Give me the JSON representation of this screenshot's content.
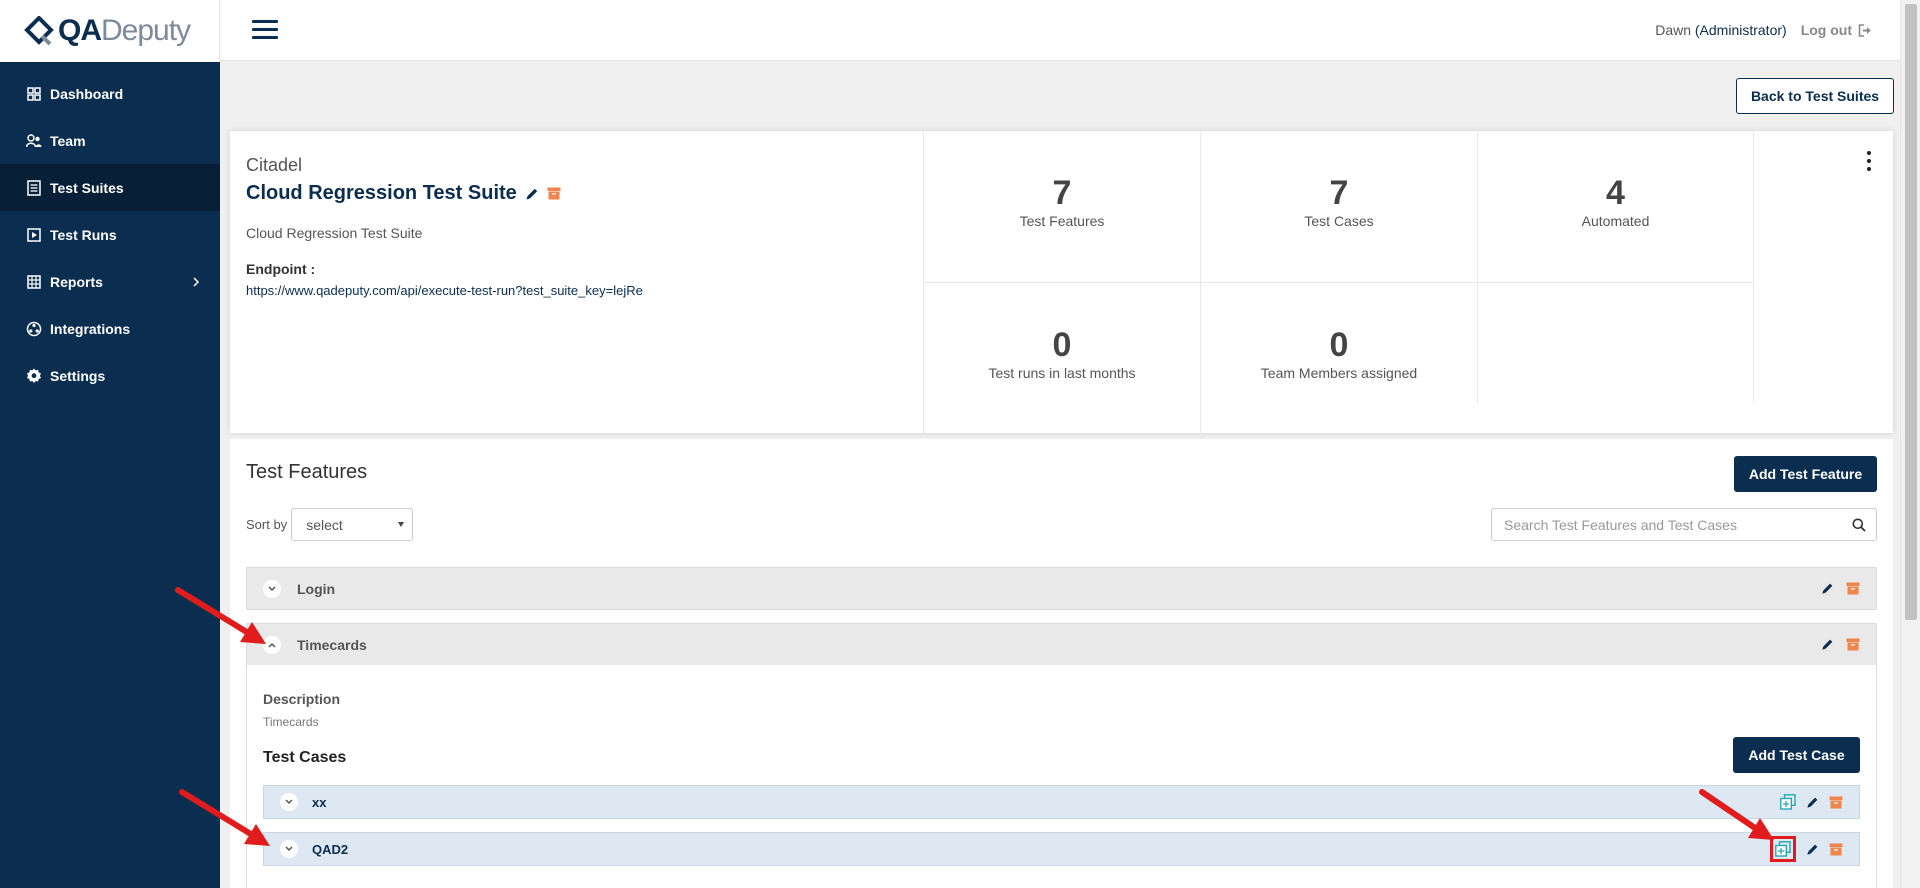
{
  "brand": {
    "logo_bold": "QA",
    "logo_light": "Deputy"
  },
  "sidebar": {
    "items": [
      {
        "label": "Dashboard",
        "icon": "dashboard-icon"
      },
      {
        "label": "Team",
        "icon": "team-icon"
      },
      {
        "label": "Test Suites",
        "icon": "test-suites-icon",
        "active": true
      },
      {
        "label": "Test Runs",
        "icon": "play-icon"
      },
      {
        "label": "Reports",
        "icon": "table-icon",
        "has_submenu": true
      },
      {
        "label": "Integrations",
        "icon": "integrations-icon"
      },
      {
        "label": "Settings",
        "icon": "gear-icon"
      }
    ]
  },
  "topbar": {
    "user_name": "Dawn",
    "user_role": "(Administrator)",
    "logout_label": "Log out"
  },
  "back_button": "Back to Test Suites",
  "suite": {
    "client": "Citadel",
    "name": "Cloud Regression Test Suite",
    "description": "Cloud Regression Test Suite",
    "endpoint_label": "Endpoint :",
    "endpoint_url": "https://www.qadeputy.com/api/execute-test-run?test_suite_key=lejRe"
  },
  "stats": [
    {
      "value": "7",
      "label": "Test Features"
    },
    {
      "value": "7",
      "label": "Test Cases"
    },
    {
      "value": "4",
      "label": "Automated"
    },
    {
      "value": "0",
      "label": "Test runs in last months"
    },
    {
      "value": "0",
      "label": "Team Members assigned"
    }
  ],
  "features_section": {
    "title": "Test Features",
    "add_button": "Add Test Feature",
    "sort_label": "Sort by",
    "sort_value": "select",
    "search_placeholder": "Search Test Features and Test Cases"
  },
  "features": [
    {
      "name": "Login",
      "expanded": false
    },
    {
      "name": "Timecards",
      "expanded": true
    }
  ],
  "expanded_feature": {
    "description_label": "Description",
    "description": "Timecards",
    "test_cases_title": "Test Cases",
    "add_test_case_button": "Add Test Case",
    "test_cases": [
      {
        "name": "xx"
      },
      {
        "name": "QAD2",
        "duplicate_highlighted": true
      }
    ]
  },
  "colors": {
    "primary": "#0b2d4f",
    "archive": "#f0844a",
    "duplicate": "#2aa7b8",
    "annotation": "#e01c1c"
  }
}
